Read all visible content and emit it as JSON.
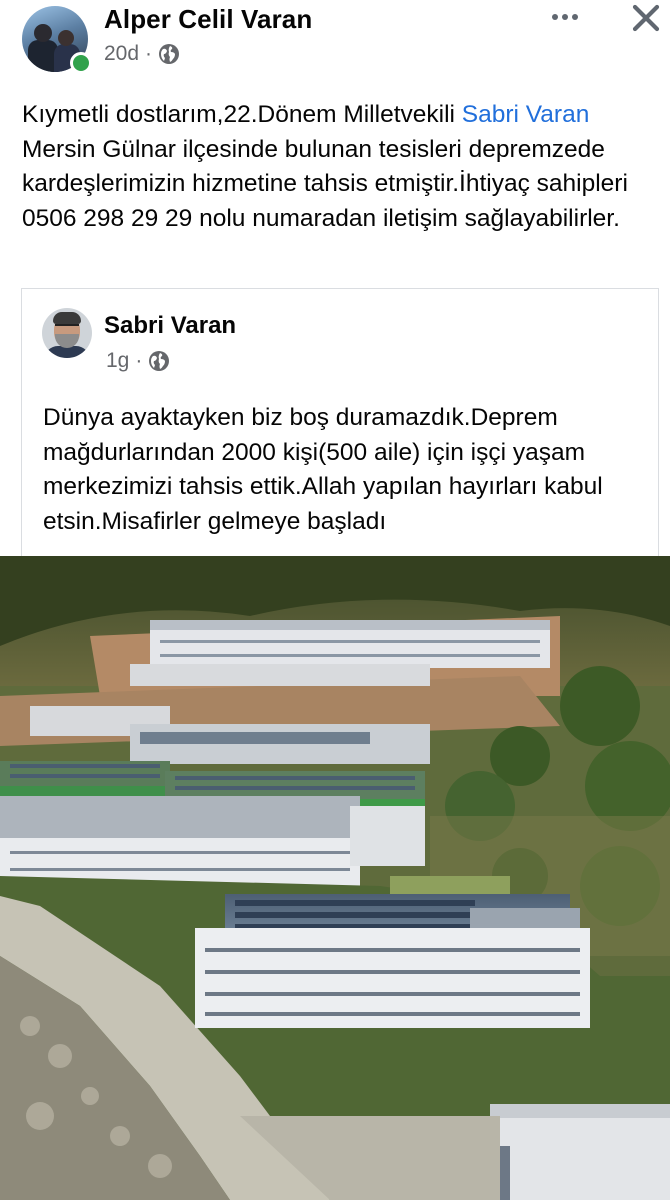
{
  "post": {
    "author": "Alper Celil Varan",
    "time": "20d",
    "separator": "·",
    "text_parts": {
      "before": "Kıymetli dostlarım,22.Dönem Milletvekili ",
      "mention": "Sabri Varan",
      "after": " Mersin Gülnar ilçesinde bulunan tesisleri depremzede kardeşlerimizin hizmetine tahsis etmiştir.İhtiyaç sahipleri 0506 298 29 29 nolu numaradan iletişim sağlayabilirler."
    }
  },
  "shared_post": {
    "author": "Sabri Varan",
    "time": "1g",
    "separator": "·",
    "text": "Dünya ayaktayken biz boş duramazdık.Deprem mağdurlarından 2000 kişi(500 aile) için işçi yaşam merkezimizi tahsis ettik.Allah yapılan hayırları kabul etsin.Misafirler gelmeye başladı"
  },
  "icons": {
    "audience": "globe-icon",
    "menu": "more-options-icon",
    "dismiss": "close-icon"
  },
  "colors": {
    "mention": "#216fdb",
    "meta": "#65676b",
    "online": "#31a24c"
  }
}
